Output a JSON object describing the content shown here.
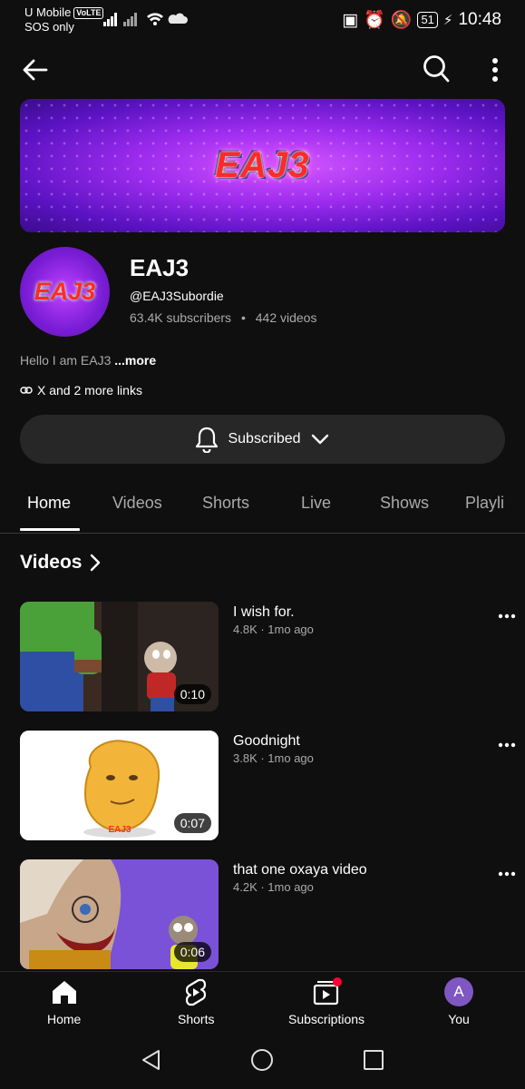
{
  "status_bar": {
    "carrier": "U Mobile",
    "volte": "VoLTE",
    "sos": "SOS only",
    "battery": "51",
    "time": "10:48"
  },
  "top_bar": {
    "icons": [
      "back-arrow-icon",
      "search-icon",
      "more-vert-icon"
    ]
  },
  "banner": {
    "logo_text": "EAJ3"
  },
  "channel": {
    "avatar_text": "EAJ3",
    "name": "EAJ3",
    "handle": "@EAJ3Subordie",
    "subscribers": "63.4K subscribers",
    "separator": "•",
    "videos_count": "442 videos",
    "description": "Hello I am EAJ3",
    "more": "...more",
    "links": "X and 2 more links"
  },
  "subscribe_button": {
    "label": "Subscribed"
  },
  "tabs": [
    {
      "label": "Home",
      "active": true
    },
    {
      "label": "Videos"
    },
    {
      "label": "Shorts"
    },
    {
      "label": "Live"
    },
    {
      "label": "Shows"
    },
    {
      "label": "Playli"
    }
  ],
  "section": {
    "title": "Videos"
  },
  "videos": [
    {
      "title": "I wish for.",
      "views": "4.8K",
      "age": "1mo ago",
      "meta": "4.8K · 1mo ago",
      "duration": "0:10"
    },
    {
      "title": "Goodnight",
      "views": "3.8K",
      "age": "1mo ago",
      "meta": "3.8K · 1mo ago",
      "duration": "0:07"
    },
    {
      "title": "that one oxaya video",
      "views": "4.2K",
      "age": "1mo ago",
      "meta": "4.2K · 1mo ago",
      "duration": "0:06"
    }
  ],
  "bottom_nav": [
    {
      "label": "Home",
      "icon": "home-icon"
    },
    {
      "label": "Shorts",
      "icon": "shorts-icon"
    },
    {
      "label": "Subscriptions",
      "icon": "subscriptions-icon"
    },
    {
      "label": "You",
      "avatar_letter": "A"
    }
  ],
  "colors": {
    "background": "#0f0f0f",
    "button_bg": "#272727",
    "secondary_text": "#aaaaaa",
    "notification_dot": "#ff0033",
    "you_avatar": "#7e57c2"
  }
}
